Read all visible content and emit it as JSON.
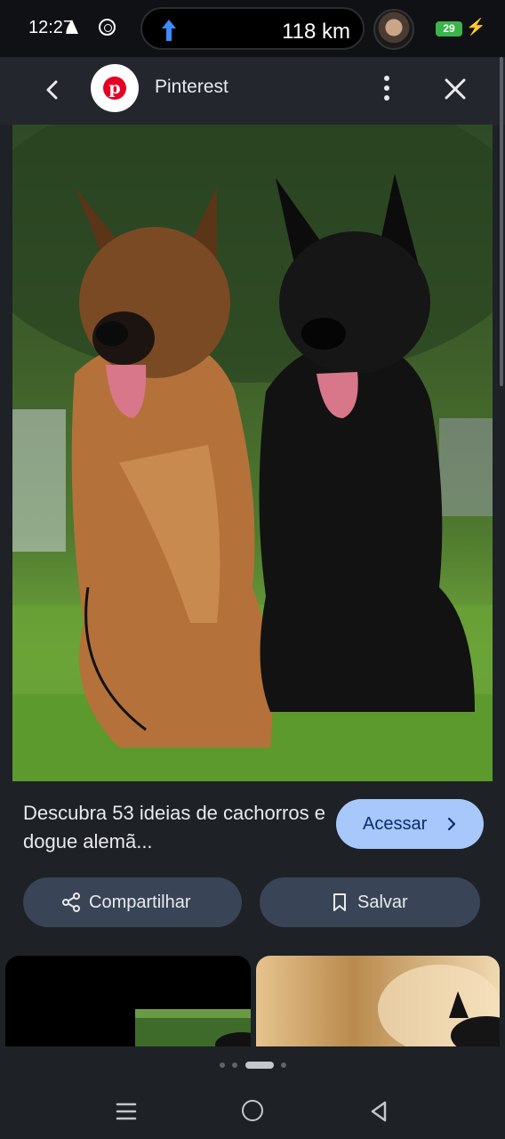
{
  "status_bar": {
    "time": "12:27",
    "navigation_distance": "118 km",
    "battery_level": "29",
    "icons": [
      "navigation-arrow-icon",
      "whatsapp-icon",
      "charging-bolt-icon"
    ]
  },
  "app_bar": {
    "title": "Pinterest",
    "icons": [
      "back-icon",
      "pinterest-logo",
      "more-vert-icon",
      "close-icon"
    ]
  },
  "result": {
    "description": "Descubra 53 ideias de cachorros e dogue alemã...",
    "access_label": "Acessar",
    "share_label": "Compartilhar",
    "save_label": "Salvar"
  },
  "pager": {
    "count": 4,
    "active_index": 2
  },
  "colors": {
    "accent_button": "#a8c7fa",
    "secondary_button": "#394457",
    "background": "#1e2126",
    "pinterest_red": "#e60023",
    "battery_green": "#3bb54a"
  }
}
